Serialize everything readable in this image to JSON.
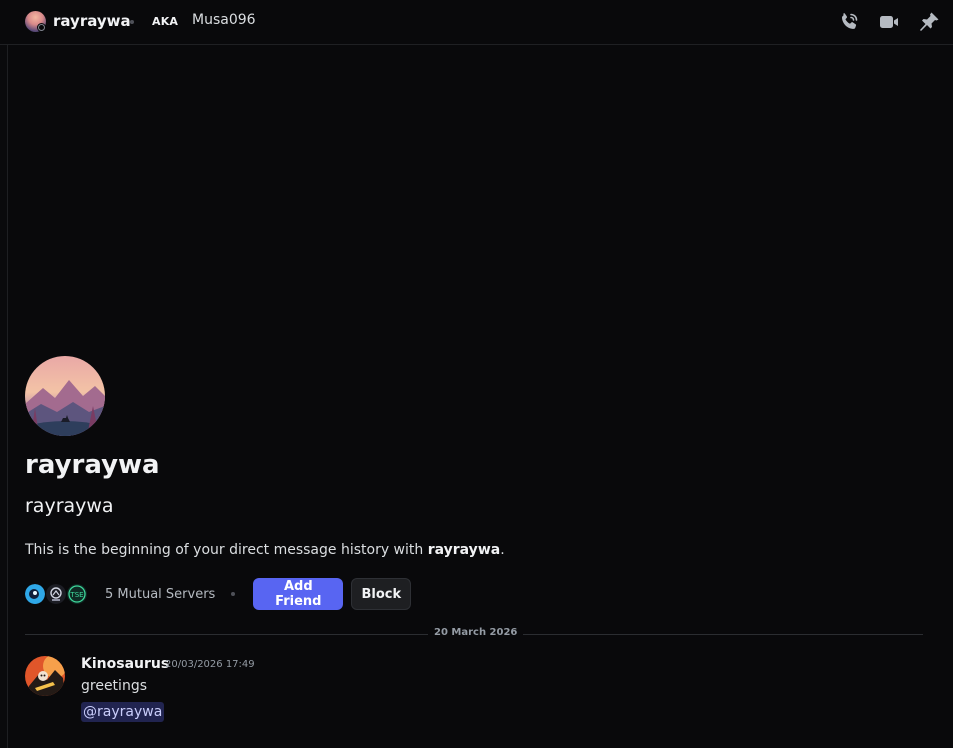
{
  "header": {
    "name": "rayraywa",
    "aka_label": "AKA",
    "aka_name": "Musa096",
    "icons": [
      "voice-call-icon",
      "video-call-icon",
      "pin-icon"
    ]
  },
  "welcome": {
    "display_name": "rayraywa",
    "username": "rayraywa",
    "intro_prefix": "This is the beginning of your direct message history with ",
    "intro_name": "rayraywa",
    "intro_suffix": ".",
    "mutual_servers": "5 Mutual Servers",
    "add_friend_label": "Add Friend",
    "block_label": "Block"
  },
  "divider": {
    "date": "20 March 2026"
  },
  "messages": [
    {
      "author": "Kinosaurus",
      "timestamp": "20/03/2026 17:49",
      "lines": [
        "greetings"
      ],
      "mention": "@rayraywa"
    }
  ],
  "colors": {
    "background": "#09090b",
    "accent": "#5865f2",
    "mention_bg": "rgba(88,101,242,0.3)"
  }
}
